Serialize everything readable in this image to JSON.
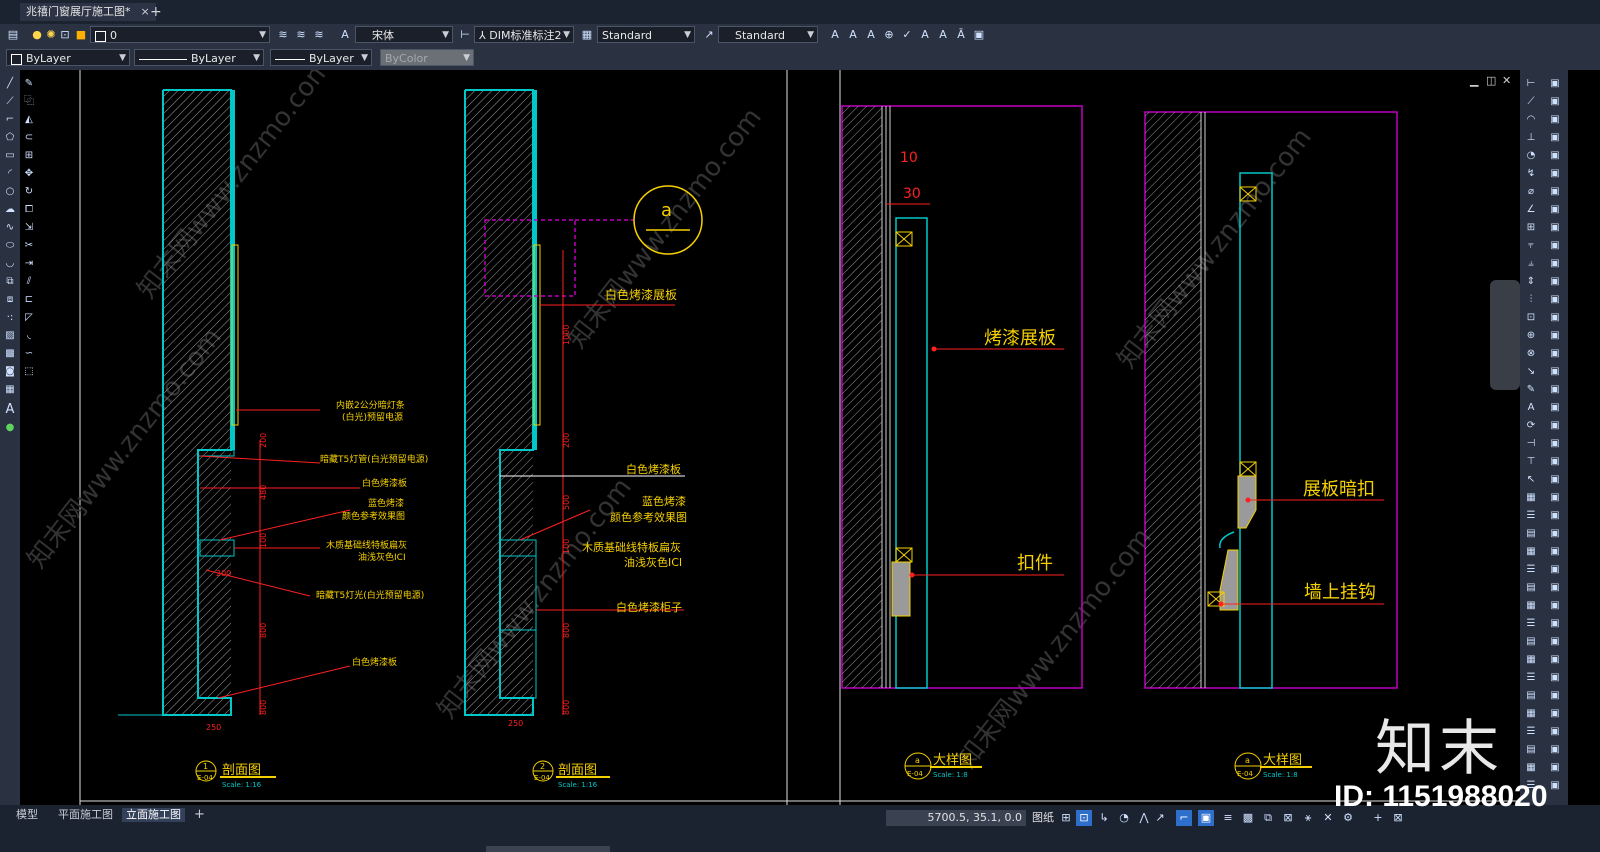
{
  "window": {
    "active_tab": "兆禧门窗展厅施工图*",
    "close": "×",
    "new_tab": "+"
  },
  "toolbar1": {
    "layer_value": "0",
    "text_style_label": "宋体",
    "dim_style_value": "DIM标准标注2",
    "table_style_value": "Standard",
    "multileader_style_value": "Standard"
  },
  "toolbar2": {
    "color_value": "ByLayer",
    "linetype_value": "ByLayer",
    "lineweight_value": "ByLayer",
    "plotstyle_value": "ByColor"
  },
  "layout_tabs": [
    {
      "label": "模型",
      "active": false
    },
    {
      "label": "平面施工图",
      "active": false
    },
    {
      "label": "立面施工图",
      "active": true
    }
  ],
  "status": {
    "coords": "5700.5, 35.1, 0.0",
    "paper_label": "图纸"
  },
  "drawing": {
    "section1": {
      "annotations": [
        "内嵌2公分暗灯条",
        "(白光)预留电源",
        "暗藏T5灯管(白光预留电源)",
        "白色烤漆板",
        "蓝色烤漆",
        "颜色参考效果图",
        "木质基础线特板扁灰",
        "油浅灰色ICI",
        "暗藏T5灯光(白光预留电源)",
        "白色烤漆板"
      ],
      "dims": [
        "200",
        "480",
        "100",
        "200",
        "800",
        "800",
        "250"
      ],
      "title_num": "1",
      "title_ref": "E-04",
      "title": "剖面图",
      "scale": "Scale: 1:16"
    },
    "section2": {
      "annotations": [
        "白色烤漆展板",
        "白色烤漆板",
        "蓝色烤漆",
        "颜色参考效果图",
        "木质基础线特板扁灰",
        "油浅灰色ICI",
        "白色烤漆柜子"
      ],
      "dims": [
        "1000",
        "200",
        "500",
        "100",
        "800",
        "800",
        "250"
      ],
      "callout": "a",
      "title_num": "2",
      "title_ref": "E-04",
      "title": "剖面图",
      "scale": "Scale: 1:16"
    },
    "detail1": {
      "dims": [
        "10",
        "30"
      ],
      "labels": [
        "烤漆展板",
        "扣件"
      ],
      "title_num": "a",
      "title_ref": "E-04",
      "title": "大样图",
      "scale": "Scale: 1:8"
    },
    "detail2": {
      "labels": [
        "展板暗扣",
        "墙上挂钩"
      ],
      "title_num": "a",
      "title_ref": "E-04",
      "title": "大样图",
      "scale": "Scale: 1:8"
    },
    "watermark_text": "知末网www.znzmo.com"
  },
  "watermark": {
    "logo": "知末",
    "id": "ID: 1151988020"
  },
  "colors": {
    "wall": "#00c8c8",
    "annotation": "#f5d000",
    "leader": "#ff2020",
    "frame": "#c000c0",
    "bg": "#000000"
  }
}
